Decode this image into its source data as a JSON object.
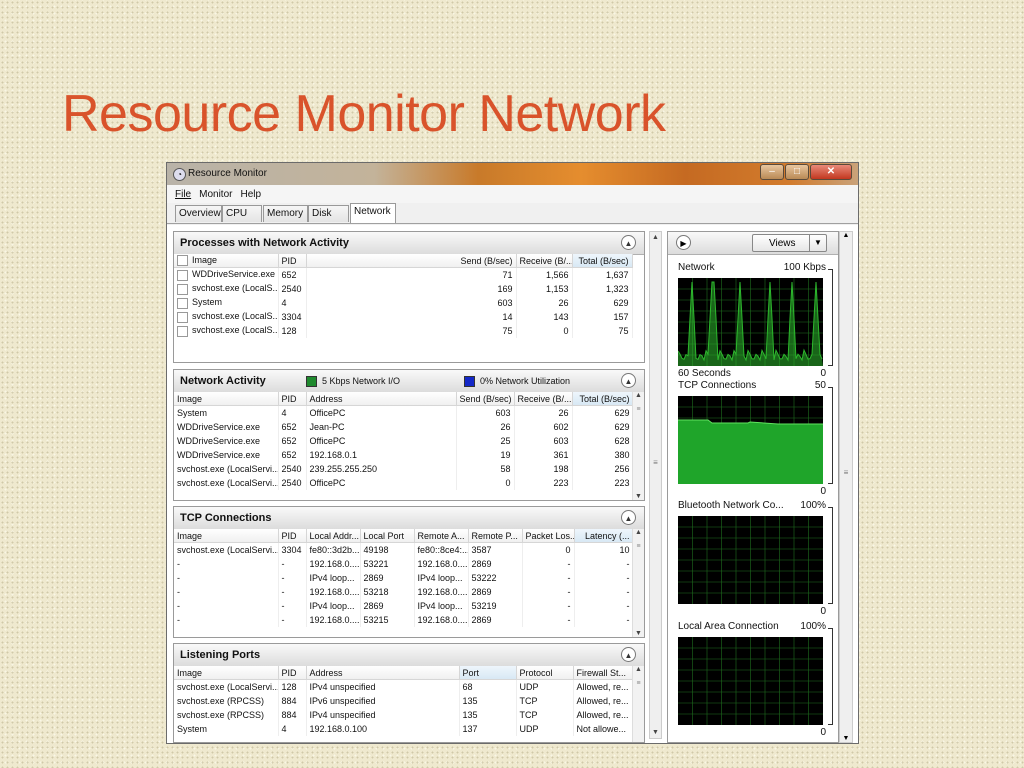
{
  "slide": {
    "title": "Resource Monitor Network"
  },
  "window": {
    "title": "Resource Monitor",
    "controls": {
      "minimize": "–",
      "maximize": "□",
      "close": "✕"
    }
  },
  "menu": [
    "File",
    "Monitor",
    "Help"
  ],
  "tabs": [
    "Overview",
    "CPU",
    "Memory",
    "Disk",
    "Network"
  ],
  "processes": {
    "title": "Processes with Network Activity",
    "columns": [
      "Image",
      "PID",
      "Send (B/sec)",
      "Receive (B/...",
      "Total (B/sec)"
    ],
    "rows": [
      [
        "WDDriveService.exe",
        "652",
        "71",
        "1,566",
        "1,637"
      ],
      [
        "svchost.exe (LocalS...",
        "2540",
        "169",
        "1,153",
        "1,323"
      ],
      [
        "System",
        "4",
        "603",
        "26",
        "629"
      ],
      [
        "svchost.exe (LocalS...",
        "3304",
        "14",
        "143",
        "157"
      ],
      [
        "svchost.exe (LocalS...",
        "128",
        "75",
        "0",
        "75"
      ]
    ]
  },
  "network_activity": {
    "title": "Network Activity",
    "legend1": "5 Kbps Network I/O",
    "legend2": "0% Network Utilization",
    "legend1_color": "#1f8a2e",
    "legend2_color": "#1428c8",
    "columns": [
      "Image",
      "PID",
      "Address",
      "Send (B/sec)",
      "Receive (B/...",
      "Total (B/sec)"
    ],
    "rows": [
      [
        "System",
        "4",
        "OfficePC",
        "603",
        "26",
        "629"
      ],
      [
        "WDDriveService.exe",
        "652",
        "Jean-PC",
        "26",
        "602",
        "629"
      ],
      [
        "WDDriveService.exe",
        "652",
        "OfficePC",
        "25",
        "603",
        "628"
      ],
      [
        "WDDriveService.exe",
        "652",
        "192.168.0.1",
        "19",
        "361",
        "380"
      ],
      [
        "svchost.exe (LocalServi...",
        "2540",
        "239.255.255.250",
        "58",
        "198",
        "256"
      ],
      [
        "svchost.exe (LocalServi...",
        "2540",
        "OfficePC",
        "0",
        "223",
        "223"
      ]
    ]
  },
  "tcp": {
    "title": "TCP Connections",
    "columns": [
      "Image",
      "PID",
      "Local Addr...",
      "Local Port",
      "Remote A...",
      "Remote P...",
      "Packet Los...",
      "Latency (..."
    ],
    "rows": [
      [
        "svchost.exe (LocalServi...",
        "3304",
        "fe80::3d2b...",
        "49198",
        "fe80::8ce4:...",
        "3587",
        "0",
        "10"
      ],
      [
        "-",
        "-",
        "192.168.0....",
        "53221",
        "192.168.0....",
        "2869",
        "-",
        "-"
      ],
      [
        "-",
        "-",
        "IPv4 loop...",
        "2869",
        "IPv4 loop...",
        "53222",
        "-",
        "-"
      ],
      [
        "-",
        "-",
        "192.168.0....",
        "53218",
        "192.168.0....",
        "2869",
        "-",
        "-"
      ],
      [
        "-",
        "-",
        "IPv4 loop...",
        "2869",
        "IPv4 loop...",
        "53219",
        "-",
        "-"
      ],
      [
        "-",
        "-",
        "192.168.0....",
        "53215",
        "192.168.0....",
        "2869",
        "-",
        "-"
      ]
    ]
  },
  "listening": {
    "title": "Listening Ports",
    "columns": [
      "Image",
      "PID",
      "Address",
      "Port",
      "Protocol",
      "Firewall St..."
    ],
    "rows": [
      [
        "svchost.exe (LocalServi...",
        "128",
        "IPv4 unspecified",
        "68",
        "UDP",
        "Allowed, re..."
      ],
      [
        "svchost.exe (RPCSS)",
        "884",
        "IPv6 unspecified",
        "135",
        "TCP",
        "Allowed, re..."
      ],
      [
        "svchost.exe (RPCSS)",
        "884",
        "IPv4 unspecified",
        "135",
        "TCP",
        "Allowed, re..."
      ],
      [
        "System",
        "4",
        "192.168.0.100",
        "137",
        "UDP",
        "Not allowe..."
      ]
    ]
  },
  "graphs": {
    "views_label": "Views",
    "items": [
      {
        "label": "Network",
        "max": "100 Kbps",
        "footer": "60 Seconds",
        "zero": "0"
      },
      {
        "label": "TCP Connections",
        "max": "50",
        "zero": "0"
      },
      {
        "label": "Bluetooth Network Co...",
        "max": "100%",
        "zero": "0"
      },
      {
        "label": "Local Area Connection",
        "max": "100%",
        "zero": "0"
      }
    ],
    "line_color": "#2db82d",
    "grid_color": "#1f6e1f"
  }
}
